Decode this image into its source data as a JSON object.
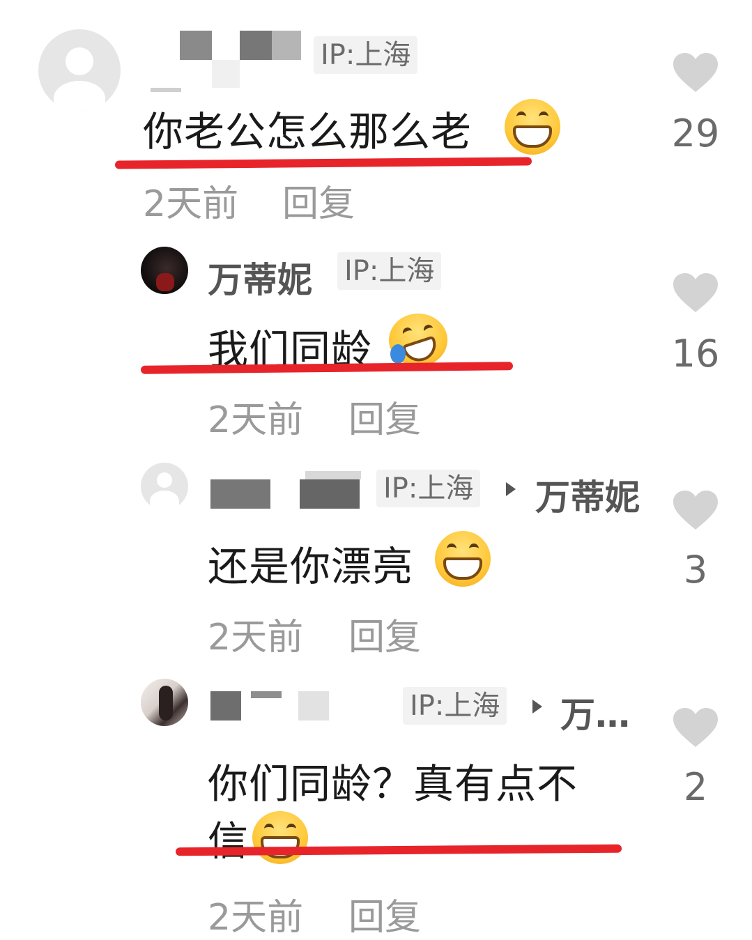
{
  "comments": [
    {
      "ip": "IP:上海",
      "text": "你老公怎么那么老",
      "time": "2天前",
      "reply": "回复",
      "likes": "29"
    },
    {
      "username": "万蒂妮",
      "ip": "IP:上海",
      "text": "我们同龄",
      "time": "2天前",
      "reply": "回复",
      "likes": "16"
    },
    {
      "ip": "IP:上海",
      "reply_to": "万蒂妮",
      "text": "还是你漂亮",
      "time": "2天前",
      "reply": "回复",
      "likes": "3"
    },
    {
      "ip": "IP:上海",
      "reply_to": "万…",
      "text_line1": "你们同龄？真有点不",
      "text_line2": "信",
      "time": "2天前",
      "reply": "回复",
      "likes": "2"
    }
  ],
  "colors": {
    "underline": "#e8242b",
    "heart": "#d3d3d3",
    "meta": "#9a9a9a"
  }
}
